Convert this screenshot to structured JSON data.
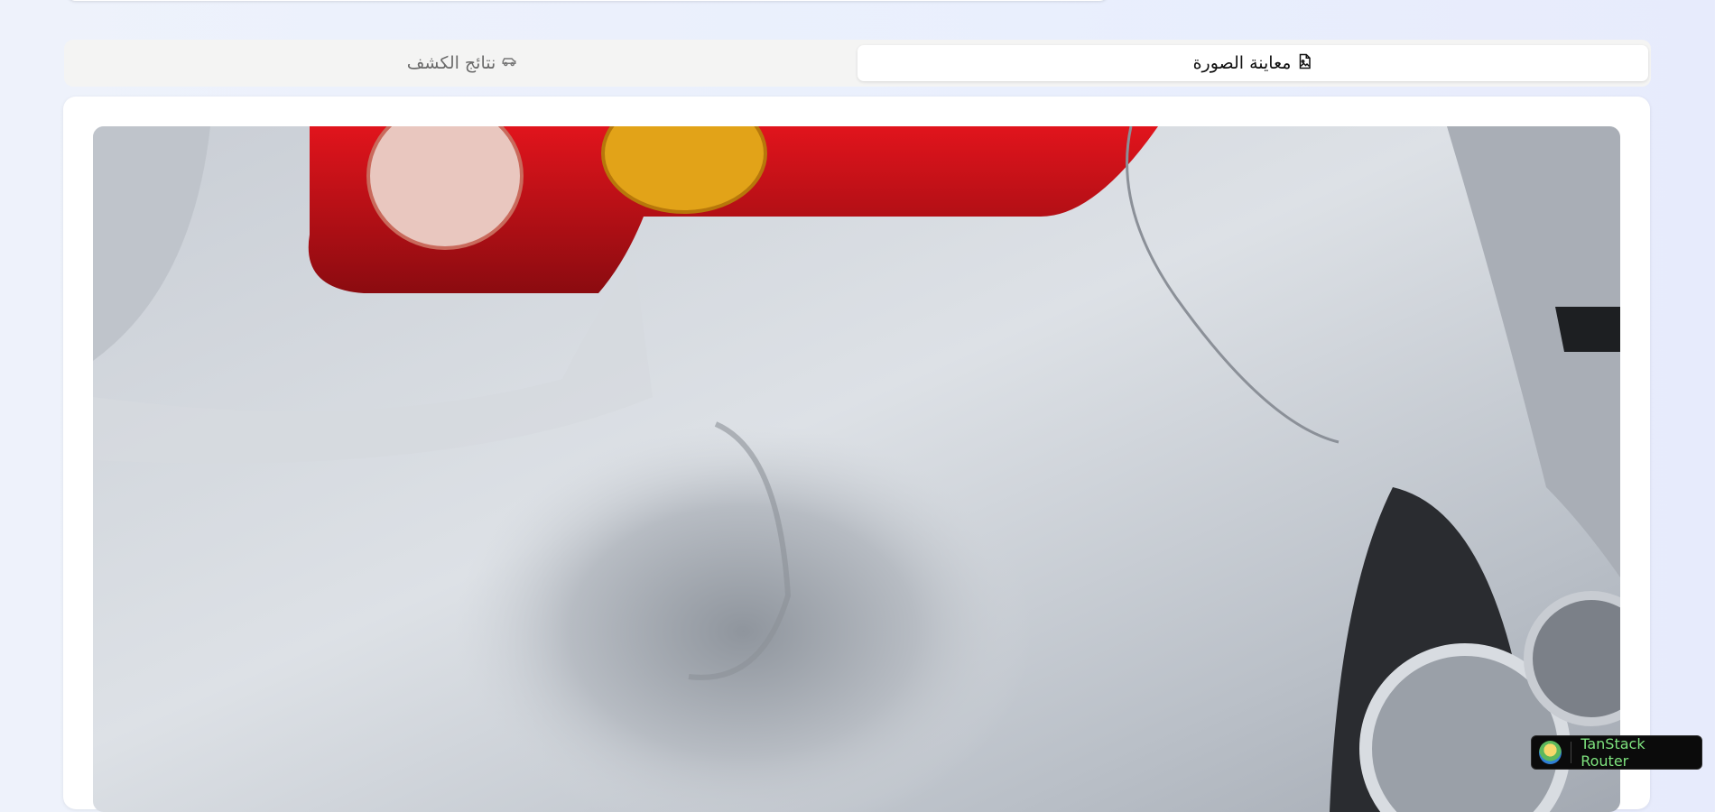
{
  "tabs": [
    {
      "label": "معاينة الصورة",
      "icon": "file-image-icon",
      "active": true
    },
    {
      "label": "نتائج الكشف",
      "icon": "car-icon",
      "active": false
    }
  ],
  "preview": {
    "subject": "silver car rear quarter panel with dent"
  },
  "devtools": {
    "label": "TanStack Router",
    "icon": "tanstack-logo-icon"
  },
  "colors": {
    "background": "#e9effd",
    "tab_bar": "#f4f4f3",
    "active_tab": "#ffffff",
    "devtools_text": "#7ee37e"
  }
}
